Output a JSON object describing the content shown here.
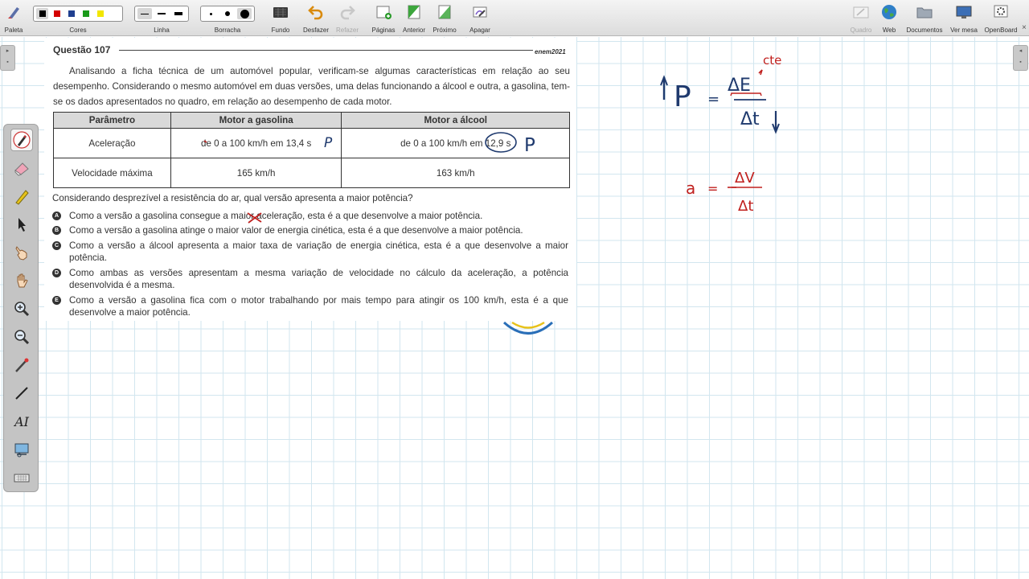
{
  "toolbar": {
    "palette": "Paleta",
    "colors": "Cores",
    "color_swatches": [
      "#000000",
      "#d40000",
      "#1f3f8f",
      "#1a9a1a",
      "#f2e600"
    ],
    "line": "Linha",
    "eraser": "Borracha",
    "background": "Fundo",
    "undo": "Desfazer",
    "redo": "Refazer",
    "pages": "Páginas",
    "previous": "Anterior",
    "next": "Próximo",
    "erase": "Apagar",
    "board": "Quadro",
    "web": "Web",
    "documents": "Documentos",
    "desktop": "Ver mesa",
    "app": "OpenBoard"
  },
  "question": {
    "title": "Questão 107",
    "brand": "enem2021",
    "intro": "Analisando a ficha técnica de um automóvel popular, verificam-se algumas características em relação ao seu desempenho. Considerando o mesmo automóvel em duas versões, uma delas funcionando a álcool e outra, a gasolina, tem-se os dados apresentados no quadro, em relação ao desempenho de cada motor.",
    "table": {
      "headers": [
        "Parâmetro",
        "Motor a gasolina",
        "Motor a álcool"
      ],
      "rows": [
        [
          "Aceleração",
          "de 0 a 100 km/h em 13,4 s",
          "de 0 a 100 km/h em 12,9 s"
        ],
        [
          "Velocidade máxima",
          "165 km/h",
          "163 km/h"
        ]
      ]
    },
    "prompt": "Considerando desprezível a resistência do ar, qual versão apresenta a maior potência?",
    "options": [
      {
        "letter": "A",
        "text": "Como a versão a gasolina consegue a maior aceleração, esta é a que desenvolve a maior potência."
      },
      {
        "letter": "B",
        "text": "Como a versão a gasolina atinge o maior valor de energia cinética, esta é a que desenvolve a maior potência."
      },
      {
        "letter": "C",
        "text": "Como a versão a álcool apresenta a maior taxa de variação de energia cinética, esta é a que desenvolve a maior potência."
      },
      {
        "letter": "D",
        "text": "Como ambas as versões apresentam a mesma variação de velocidade no cálculo da aceleração, a potência desenvolvida é a mesma."
      },
      {
        "letter": "E",
        "text": "Como a versão a gasolina fica com o motor trabalhando por mais tempo para atingir os 100 km/h, esta é a que desenvolve a maior potência."
      }
    ]
  },
  "annotations": {
    "table_mark_1": "P",
    "table_mark_2": "P",
    "power_symbol": "P",
    "equals": "=",
    "delta_e": "ΔE",
    "delta_t": "Δt",
    "constant": "cte",
    "accel_symbol": "a",
    "delta_v": "ΔV",
    "delta_t_2": "Δt",
    "ink_blue": "#1f3a6e",
    "ink_red": "#c0201e"
  }
}
